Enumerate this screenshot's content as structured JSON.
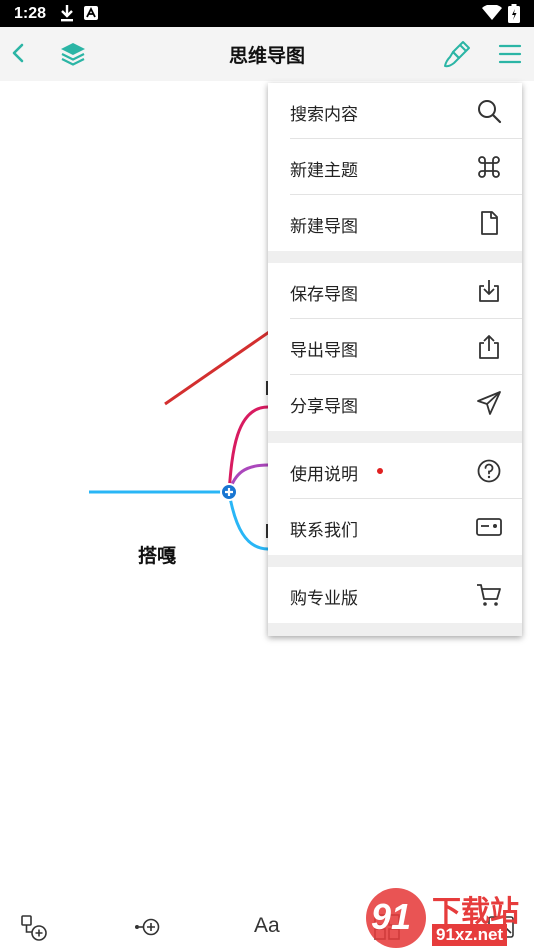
{
  "status_bar": {
    "time": "1:28"
  },
  "toolbar": {
    "title": "思维导图"
  },
  "canvas": {
    "root_topic": "搭嘎"
  },
  "menu": {
    "items": [
      {
        "label": "搜索内容",
        "icon": "search-icon"
      },
      {
        "label": "新建主题",
        "icon": "command-icon"
      },
      {
        "label": "新建导图",
        "icon": "new-file-icon"
      },
      {
        "label": "保存导图",
        "icon": "download-box-icon"
      },
      {
        "label": "导出导图",
        "icon": "export-icon"
      },
      {
        "label": "分享导图",
        "icon": "send-icon"
      },
      {
        "label": "使用说明",
        "icon": "help-icon",
        "badge": true
      },
      {
        "label": "联系我们",
        "icon": "contact-card-icon"
      },
      {
        "label": "购专业版",
        "icon": "cart-icon"
      }
    ]
  },
  "bottom_toolbar": {
    "text_style_label": "Aa"
  },
  "watermark": {
    "number": "91",
    "title": "下载站",
    "url": "91xz.net"
  },
  "colors": {
    "accent": "#2bb5a5",
    "branch_blue": "#29b6f6",
    "branch_red": "#d81b60",
    "branch_purple": "#ab47bc",
    "node_handle": "#1976d2",
    "annotation_arrow": "#d32f2f",
    "badge_red": "#e02020"
  }
}
